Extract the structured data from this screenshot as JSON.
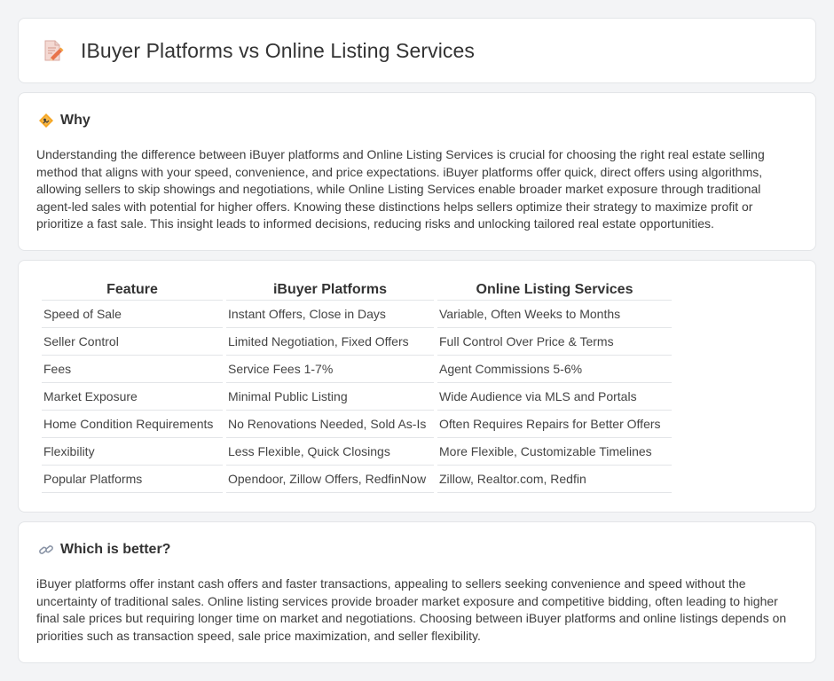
{
  "header": {
    "title": "IBuyer Platforms vs Online Listing Services",
    "icon": "document-pencil-icon"
  },
  "why": {
    "heading": "Why",
    "icon": "diamond-sign-icon",
    "body": "Understanding the difference between iBuyer platforms and Online Listing Services is crucial for choosing the right real estate selling method that aligns with your speed, convenience, and price expectations. iBuyer platforms offer quick, direct offers using algorithms, allowing sellers to skip showings and negotiations, while Online Listing Services enable broader market exposure through traditional agent-led sales with potential for higher offers. Knowing these distinctions helps sellers optimize their strategy to maximize profit or prioritize a fast sale. This insight leads to informed decisions, reducing risks and unlocking tailored real estate opportunities."
  },
  "comparison": {
    "headers": [
      "Feature",
      "iBuyer Platforms",
      "Online Listing Services"
    ],
    "rows": [
      [
        "Speed of Sale",
        "Instant Offers, Close in Days",
        "Variable, Often Weeks to Months"
      ],
      [
        "Seller Control",
        "Limited Negotiation, Fixed Offers",
        "Full Control Over Price & Terms"
      ],
      [
        "Fees",
        "Service Fees 1-7%",
        "Agent Commissions 5-6%"
      ],
      [
        "Market Exposure",
        "Minimal Public Listing",
        "Wide Audience via MLS and Portals"
      ],
      [
        "Home Condition Requirements",
        "No Renovations Needed, Sold As-Is",
        "Often Requires Repairs for Better Offers"
      ],
      [
        "Flexibility",
        "Less Flexible, Quick Closings",
        "More Flexible, Customizable Timelines"
      ],
      [
        "Popular Platforms",
        "Opendoor, Zillow Offers, RedfinNow",
        "Zillow, Realtor.com, Redfin"
      ]
    ]
  },
  "better": {
    "heading": "Which is better?",
    "icon": "link-icon",
    "body": "iBuyer platforms offer instant cash offers and faster transactions, appealing to sellers seeking convenience and speed without the uncertainty of traditional sales. Online listing services provide broader market exposure and competitive bidding, often leading to higher final sale prices but requiring longer time on market and negotiations. Choosing between iBuyer platforms and online listings depends on priorities such as transaction speed, sale price maximization, and seller flexibility."
  }
}
